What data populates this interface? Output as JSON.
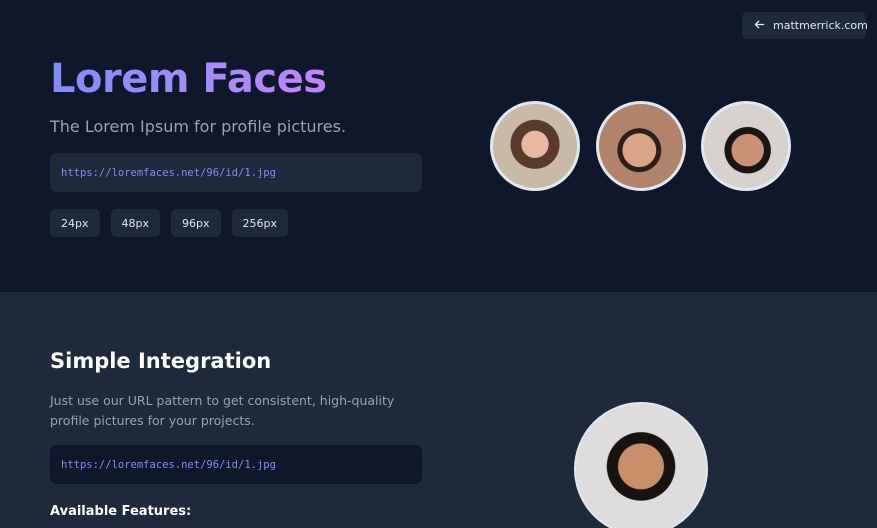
{
  "header": {
    "back_link_label": "mattmerrick.com"
  },
  "hero": {
    "title": "Lorem Faces",
    "subtitle": "The Lorem Ipsum for profile pictures.",
    "example_url": "https://loremfaces.net/96/id/1.jpg",
    "sizes": [
      "24px",
      "48px",
      "96px",
      "256px"
    ]
  },
  "integration": {
    "title": "Simple Integration",
    "description": "Just use our URL pattern to get consistent, high-quality profile pictures for your projects.",
    "example_url": "https://loremfaces.net/96/id/1.jpg",
    "features_heading": "Available Features:"
  },
  "colors": {
    "background": "#0f172a",
    "section_background": "#1e293b",
    "accent": "#818cf8",
    "accent_secondary": "#c084fc"
  }
}
